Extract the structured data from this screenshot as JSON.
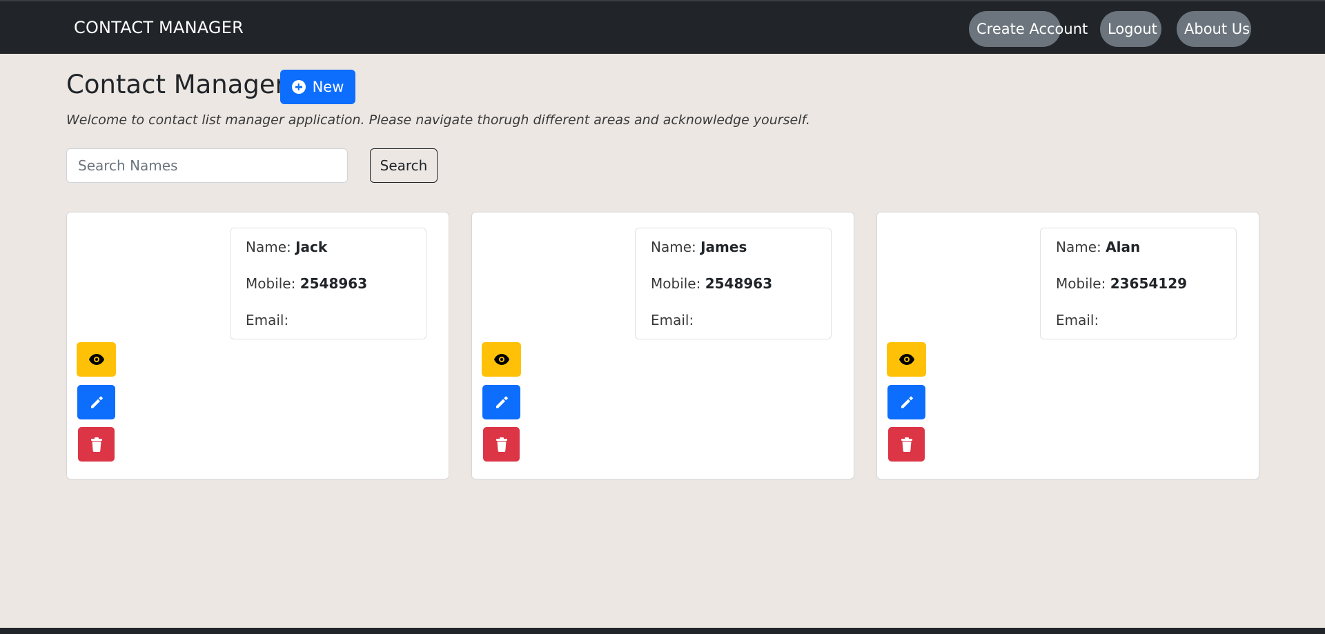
{
  "navbar": {
    "brand": "CONTACT MANAGER",
    "create_account": "Create Account",
    "logout": "Logout",
    "about_us": "About Us"
  },
  "header": {
    "title": "Contact Manager",
    "new_button": "New",
    "welcome": "Welcome to contact list manager application. Please navigate thorugh different areas and acknowledge yourself."
  },
  "search": {
    "placeholder": "Search Names",
    "value": "",
    "button": "Search"
  },
  "labels": {
    "name": "Name:",
    "mobile": "Mobile:",
    "email": "Email:"
  },
  "contacts": [
    {
      "name": "Jack",
      "mobile": "2548963",
      "email": ""
    },
    {
      "name": "James",
      "mobile": "2548963",
      "email": ""
    },
    {
      "name": "Alan",
      "mobile": "23654129",
      "email": ""
    }
  ],
  "colors": {
    "navbar": "#212529",
    "background": "#ece7e3",
    "primary": "#0d6efd",
    "warning": "#ffc107",
    "danger": "#dc3545",
    "secondary": "#6c757d"
  }
}
